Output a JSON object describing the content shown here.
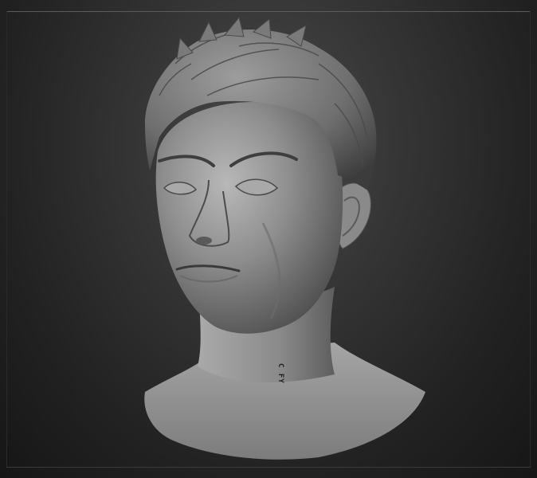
{
  "viewport": {
    "subject": "sculpted-head-model"
  },
  "annotation": {
    "neck_text": "C FY"
  },
  "colors": {
    "background_center": "#4a4a4a",
    "background_edge": "#161616",
    "clay": "#9a9a9a",
    "clay_shadow": "#3a3a3a"
  }
}
